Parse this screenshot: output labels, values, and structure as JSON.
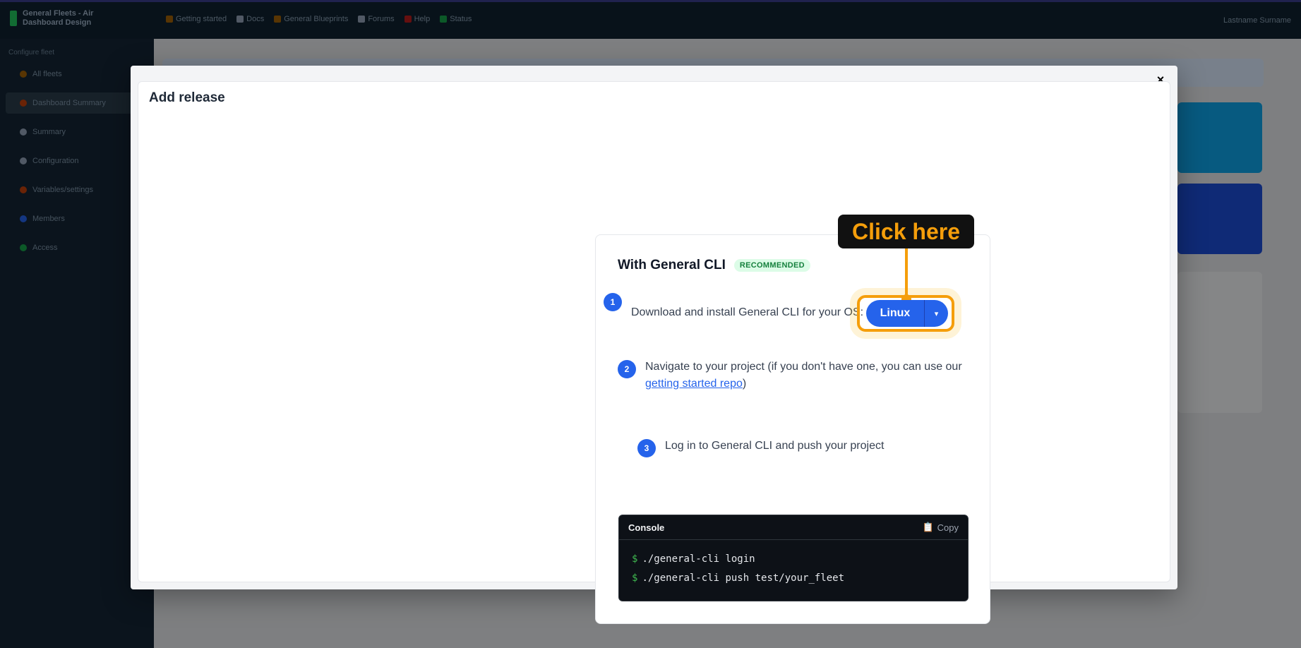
{
  "app": {
    "brand_line1": "General Fleets - Air",
    "brand_line2": "Dashboard Design",
    "top_nav": [
      {
        "label": "Getting started",
        "color": "#a16207"
      },
      {
        "label": "Docs",
        "color": "#94a3b8"
      },
      {
        "label": "General Blueprints",
        "color": "#a16207"
      },
      {
        "label": "Forums",
        "color": "#94a3b8"
      },
      {
        "label": "Help",
        "color": "#b91c1c"
      },
      {
        "label": "Status",
        "color": "#16a34a"
      }
    ],
    "top_right": "Lastname Surname",
    "sidebar_heading": "Configure fleet",
    "sidebar_items": [
      {
        "label": "All fleets",
        "color": "#a16207"
      },
      {
        "label": "Dashboard Summary",
        "color": "#c2410c"
      },
      {
        "label": "Summary",
        "color": "#94a3b8"
      },
      {
        "label": "Configuration",
        "color": "#94a3b8"
      },
      {
        "label": "Variables/settings",
        "color": "#c2410c"
      },
      {
        "label": "Members",
        "color": "#2563eb"
      },
      {
        "label": "Access",
        "color": "#16a34a"
      }
    ]
  },
  "modal": {
    "title": "Add release",
    "close_icon": "×"
  },
  "card": {
    "title": "With General CLI",
    "badge": "RECOMMENDED",
    "steps": [
      {
        "num": "1",
        "text": "Download and install General CLI for your OS:"
      },
      {
        "num": "2",
        "text_before": "Navigate to your project (if you don't have one, you can use our ",
        "link": "getting started repo",
        "text_after": ")"
      },
      {
        "num": "3",
        "text": "Log in to General CLI and push your project"
      }
    ],
    "os_select": {
      "value": "Linux",
      "caret": "▾"
    },
    "callout": "Click here",
    "console": {
      "title": "Console",
      "copy_icon": "📋",
      "copy_label": "Copy",
      "prompt": "$",
      "lines": [
        "./general-cli login",
        "./general-cli push test/your_fleet"
      ]
    }
  },
  "colors": {
    "accent": "#2563eb",
    "highlight": "#f59e0b",
    "badge_text": "#15803d"
  }
}
